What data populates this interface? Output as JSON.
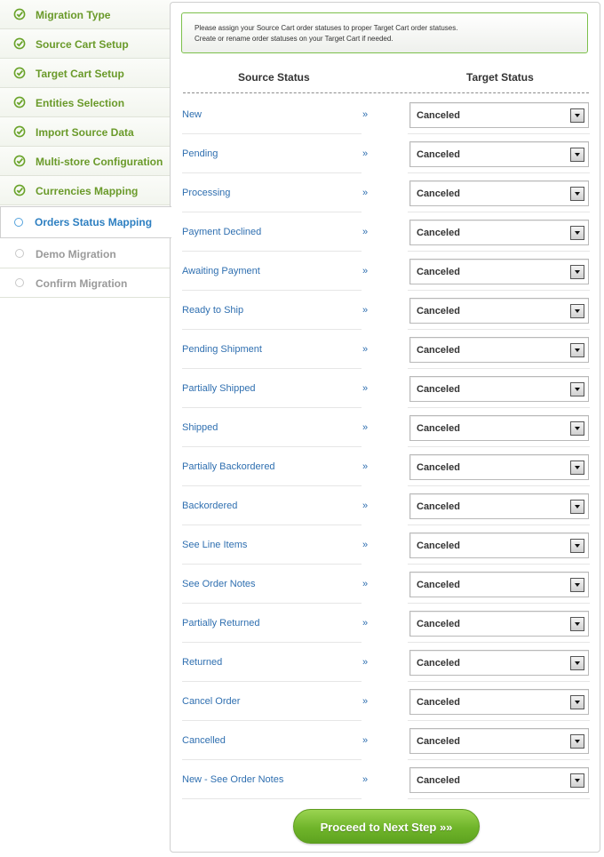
{
  "sidebar": {
    "steps": [
      {
        "label": "Migration Type",
        "state": "done"
      },
      {
        "label": "Source Cart Setup",
        "state": "done"
      },
      {
        "label": "Target Cart Setup",
        "state": "done"
      },
      {
        "label": "Entities Selection",
        "state": "done"
      },
      {
        "label": "Import Source Data",
        "state": "done"
      },
      {
        "label": "Multi-store Configuration",
        "state": "done"
      },
      {
        "label": "Currencies Mapping",
        "state": "done"
      },
      {
        "label": "Orders Status Mapping",
        "state": "active"
      },
      {
        "label": "Demo Migration",
        "state": "pending"
      },
      {
        "label": "Confirm Migration",
        "state": "pending"
      }
    ]
  },
  "notice": {
    "line1": "Please assign your Source Cart order statuses to proper Target Cart order statuses.",
    "line2": "Create or rename order statuses on your Target Cart if needed."
  },
  "table": {
    "source_header": "Source Status",
    "target_header": "Target Status",
    "arrow": "»",
    "rows": [
      {
        "source": "New",
        "target": "Canceled"
      },
      {
        "source": "Pending",
        "target": "Canceled"
      },
      {
        "source": "Processing",
        "target": "Canceled"
      },
      {
        "source": "Payment Declined",
        "target": "Canceled"
      },
      {
        "source": "Awaiting Payment",
        "target": "Canceled"
      },
      {
        "source": "Ready to Ship",
        "target": "Canceled"
      },
      {
        "source": "Pending Shipment",
        "target": "Canceled"
      },
      {
        "source": "Partially Shipped",
        "target": "Canceled"
      },
      {
        "source": "Shipped",
        "target": "Canceled"
      },
      {
        "source": "Partially Backordered",
        "target": "Canceled"
      },
      {
        "source": "Backordered",
        "target": "Canceled"
      },
      {
        "source": "See Line Items",
        "target": "Canceled"
      },
      {
        "source": "See Order Notes",
        "target": "Canceled"
      },
      {
        "source": "Partially Returned",
        "target": "Canceled"
      },
      {
        "source": "Returned",
        "target": "Canceled"
      },
      {
        "source": "Cancel Order",
        "target": "Canceled"
      },
      {
        "source": "Cancelled",
        "target": "Canceled"
      },
      {
        "source": "New - See Order Notes",
        "target": "Canceled"
      }
    ]
  },
  "proceed_button": "Proceed to Next Step »»",
  "colors": {
    "done_green": "#6a9a2a",
    "active_blue": "#2d7fc1",
    "link_blue": "#2f6fb0",
    "button_green": "#6fb42a"
  }
}
